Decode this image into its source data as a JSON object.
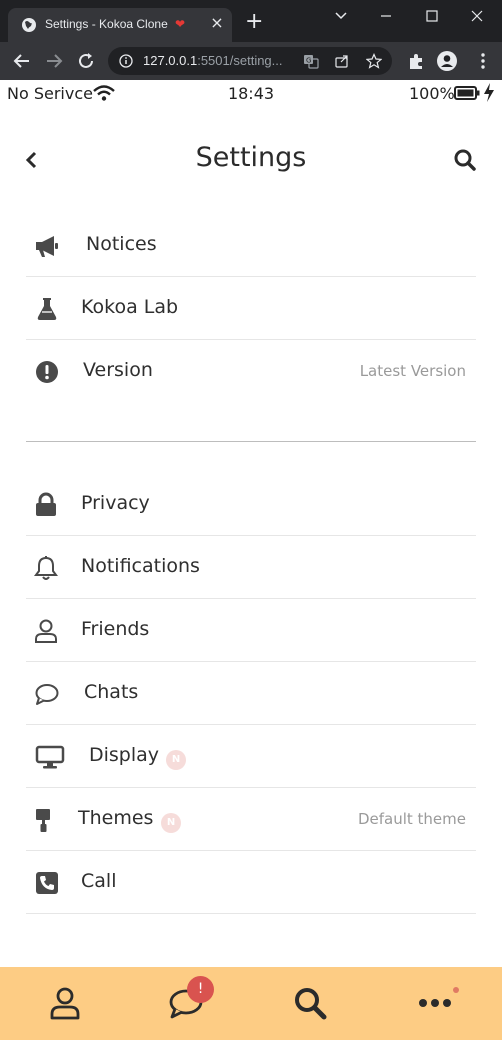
{
  "browser": {
    "tab_title": "Settings - Kokoa Clone",
    "tab_heart": "❤",
    "url_host": "127.0.0.1",
    "url_rest": ":5501/setting..."
  },
  "status_bar": {
    "carrier": "No Serivce",
    "time": "18:43",
    "battery": "100%"
  },
  "header": {
    "title": "Settings"
  },
  "settings": {
    "group1": [
      {
        "label": "Notices",
        "icon": "megaphone-icon"
      },
      {
        "label": "Kokoa Lab",
        "icon": "flask-icon"
      },
      {
        "label": "Version",
        "icon": "exclamation-circle-icon",
        "meta": "Latest Version"
      }
    ],
    "group2": [
      {
        "label": "Privacy",
        "icon": "lock-icon"
      },
      {
        "label": "Notifications",
        "icon": "bell-icon"
      },
      {
        "label": "Friends",
        "icon": "user-icon"
      },
      {
        "label": "Chats",
        "icon": "comment-icon"
      },
      {
        "label": "Display",
        "icon": "desktop-icon",
        "badge": "N"
      },
      {
        "label": "Themes",
        "icon": "paint-roller-icon",
        "badge": "N",
        "meta": "Default theme"
      },
      {
        "label": "Call",
        "icon": "phone-square-icon"
      }
    ]
  },
  "tab_bar": {
    "items": [
      {
        "icon": "user-icon"
      },
      {
        "icon": "comment-icon",
        "badge": "!"
      },
      {
        "icon": "search-icon"
      },
      {
        "icon": "ellipsis-icon"
      }
    ]
  },
  "colors": {
    "tab_bar_bg": "#fdcc84",
    "badge_red": "#d9534f",
    "n_badge_bg": "#f6dcda",
    "text": "#2f2f2f",
    "icon": "#4a4a4a"
  }
}
